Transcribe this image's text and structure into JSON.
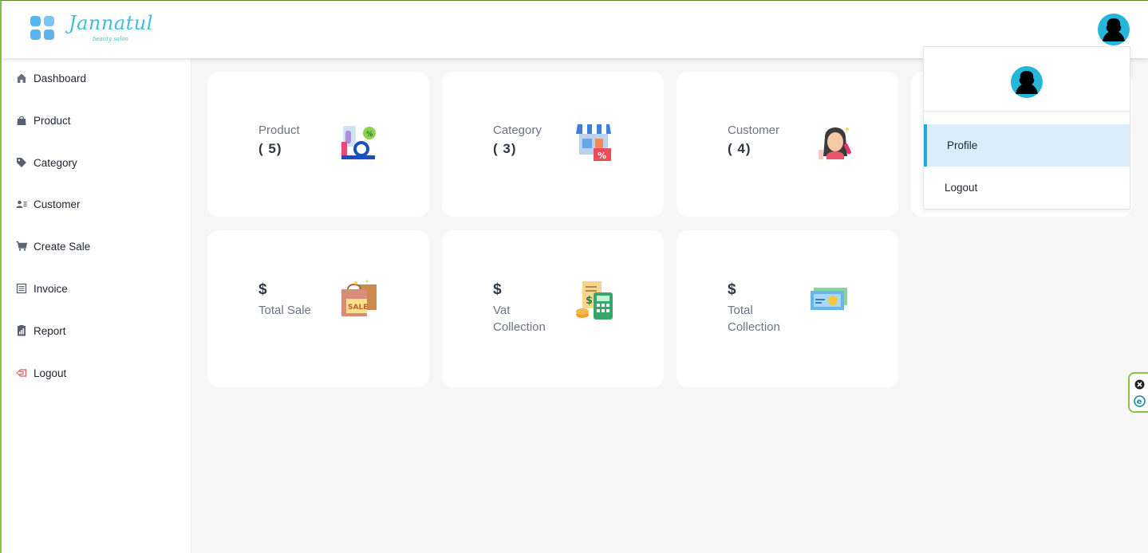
{
  "brand": {
    "name": "Jannatul",
    "tagline": "beauty salon"
  },
  "sidebar": {
    "items": [
      {
        "label": "Dashboard",
        "icon": "home-icon"
      },
      {
        "label": "Product",
        "icon": "bag-icon"
      },
      {
        "label": "Category",
        "icon": "tag-icon"
      },
      {
        "label": "Customer",
        "icon": "users-icon"
      },
      {
        "label": "Create Sale",
        "icon": "cart-icon"
      },
      {
        "label": "Invoice",
        "icon": "invoice-icon"
      },
      {
        "label": "Report",
        "icon": "report-icon"
      },
      {
        "label": "Logout",
        "icon": "logout-icon"
      }
    ]
  },
  "cards": {
    "product": {
      "title": "Product",
      "count": "( 5)"
    },
    "category": {
      "title": "Category",
      "count": "( 3)"
    },
    "customer": {
      "title": "Customer",
      "count": "( 4)"
    },
    "total_sale": {
      "symbol": "$",
      "title": "Total Sale"
    },
    "vat_collection": {
      "symbol": "$",
      "title_line1": "Vat",
      "title_line2": "Collection"
    },
    "total_collection": {
      "symbol": "$",
      "title_line1": "Total",
      "title_line2": "Collection"
    }
  },
  "dropdown": {
    "items": [
      {
        "label": "Profile",
        "active": true
      },
      {
        "label": "Logout",
        "active": false
      }
    ]
  },
  "colors": {
    "accent": "#22a7dc",
    "border": "#8bc34a",
    "avatar_bg": "#25b6d9"
  }
}
